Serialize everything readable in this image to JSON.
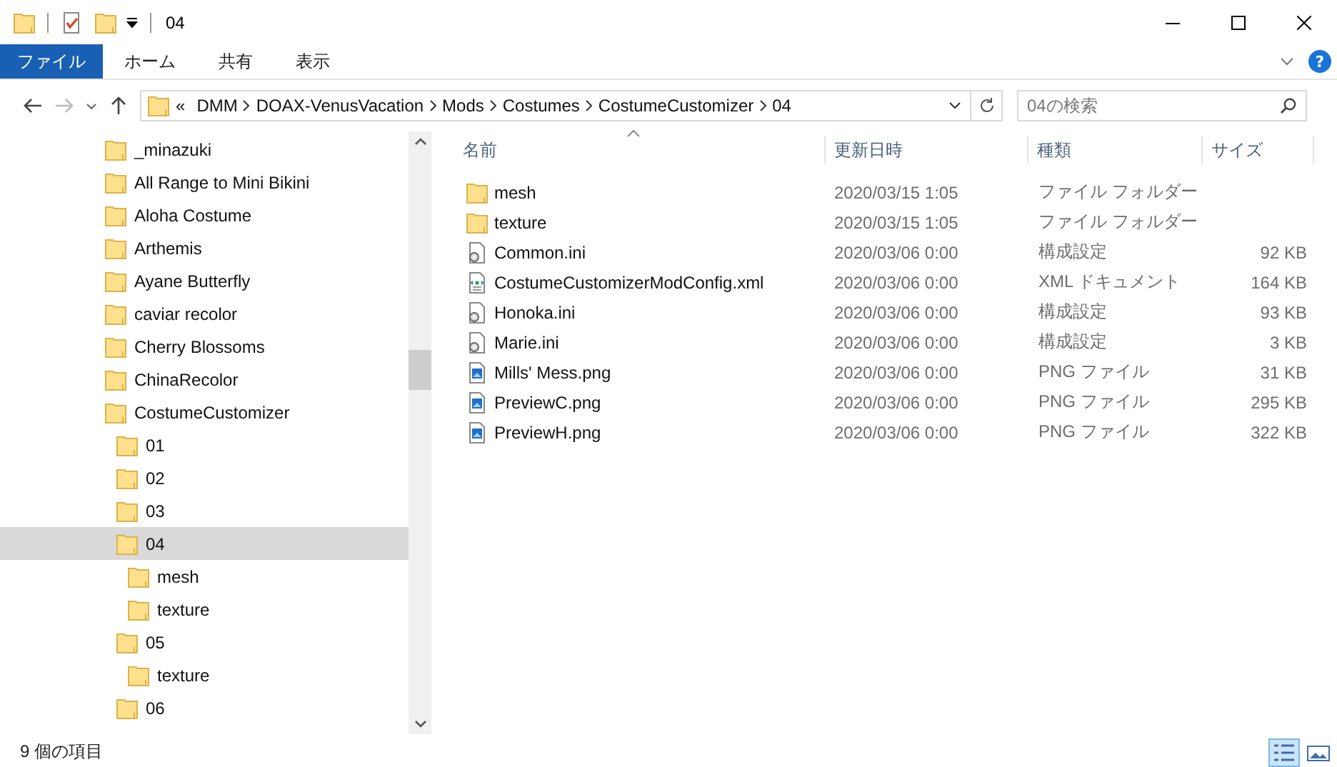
{
  "window": {
    "title": "04"
  },
  "ribbon": {
    "tabs": [
      {
        "label": "ファイル",
        "kind": "file"
      },
      {
        "label": "ホーム",
        "kind": "tab"
      },
      {
        "label": "共有",
        "kind": "tab"
      },
      {
        "label": "表示",
        "kind": "tab"
      }
    ],
    "help": "?"
  },
  "address_bar": {
    "overflow": "«",
    "crumbs": [
      "DMM",
      "DOAX-VenusVacation",
      "Mods",
      "Costumes",
      "CostumeCustomizer",
      "04"
    ],
    "search": {
      "placeholder": "04の検索"
    }
  },
  "nav_tree": [
    {
      "label": "_minazuki",
      "selected": false
    },
    {
      "label": "All Range to Mini Bikini",
      "selected": false
    },
    {
      "label": "Aloha Costume",
      "selected": false
    },
    {
      "label": "Arthemis",
      "selected": false
    },
    {
      "label": "Ayane Butterfly",
      "selected": false
    },
    {
      "label": "caviar recolor",
      "selected": false
    },
    {
      "label": "Cherry Blossoms",
      "selected": false
    },
    {
      "label": "ChinaRecolor",
      "selected": false
    },
    {
      "label": "CostumeCustomizer",
      "selected": false,
      "children": [
        {
          "label": "01",
          "selected": false
        },
        {
          "label": "02",
          "selected": false
        },
        {
          "label": "03",
          "selected": false
        },
        {
          "label": "04",
          "selected": true,
          "children": [
            {
              "label": "mesh",
              "selected": false
            },
            {
              "label": "texture",
              "selected": false
            }
          ]
        },
        {
          "label": "05",
          "selected": false,
          "children": [
            {
              "label": "texture",
              "selected": false
            }
          ]
        },
        {
          "label": "06",
          "selected": false
        }
      ]
    }
  ],
  "file_list": {
    "columns": [
      "名前",
      "更新日時",
      "種類",
      "サイズ"
    ],
    "rows": [
      {
        "kind": "folder",
        "name": "mesh",
        "modified": "2020/03/15 1:05",
        "type": "ファイル フォルダー"
      },
      {
        "kind": "folder",
        "name": "texture",
        "modified": "2020/03/15 1:05",
        "type": "ファイル フォルダー"
      },
      {
        "kind": "config",
        "name": "Common.ini",
        "modified": "2020/03/06 0:00",
        "type": "構成設定",
        "size": "92 KB"
      },
      {
        "kind": "xml",
        "name": "CostumeCustomizerModConfig.xml",
        "modified": "2020/03/06 0:00",
        "type": "XML ドキュメント",
        "size": "164 KB"
      },
      {
        "kind": "config",
        "name": "Honoka.ini",
        "modified": "2020/03/06 0:00",
        "type": "構成設定",
        "size": "93 KB"
      },
      {
        "kind": "config",
        "name": "Marie.ini",
        "modified": "2020/03/06 0:00",
        "type": "構成設定",
        "size": "3 KB"
      },
      {
        "kind": "image",
        "name": "Mills' Mess.png",
        "modified": "2020/03/06 0:00",
        "type": "PNG ファイル",
        "size": "31 KB"
      },
      {
        "kind": "image",
        "name": "PreviewC.png",
        "modified": "2020/03/06 0:00",
        "type": "PNG ファイル",
        "size": "295 KB"
      },
      {
        "kind": "image",
        "name": "PreviewH.png",
        "modified": "2020/03/06 0:00",
        "type": "PNG ファイル",
        "size": "322 KB"
      }
    ]
  },
  "status_bar": {
    "item_count": "9 個の項目",
    "views": [
      {
        "kind": "details",
        "selected": true
      },
      {
        "kind": "large-icons",
        "selected": false
      }
    ]
  }
}
